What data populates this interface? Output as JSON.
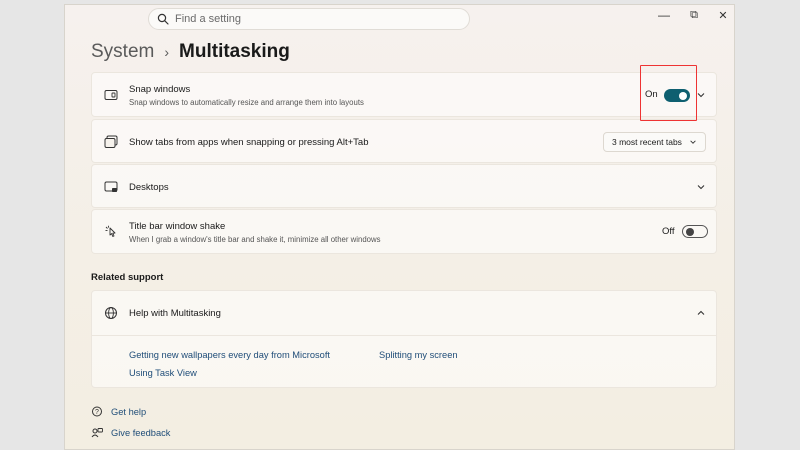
{
  "search": {
    "placeholder": "Find a setting",
    "icon": "search-icon"
  },
  "window_controls": {
    "minimize": "—",
    "restore": "⧉",
    "close": "✕"
  },
  "breadcrumb": {
    "parent": "System",
    "separator": "›",
    "current": "Multitasking"
  },
  "settings": [
    {
      "title": "Snap windows",
      "description": "Snap windows to automatically resize and arrange them into layouts",
      "icon": "snap-windows-icon",
      "toggle_label": "On",
      "toggle_state": "on",
      "expandable": true
    },
    {
      "title": "Show tabs from apps when snapping or pressing Alt+Tab",
      "icon": "tabs-icon",
      "dropdown_value": "3 most recent tabs"
    },
    {
      "title": "Desktops",
      "icon": "desktops-icon",
      "expandable": true
    },
    {
      "title": "Title bar window shake",
      "description": "When I grab a window's title bar and shake it, minimize all other windows",
      "icon": "window-shake-icon",
      "toggle_label": "Off",
      "toggle_state": "off"
    }
  ],
  "related_support": {
    "label": "Related support",
    "help": {
      "title": "Help with Multitasking",
      "icon": "globe-icon",
      "links": [
        "Getting new wallpapers every day from Microsoft",
        "Splitting my screen",
        "Using Task View"
      ]
    }
  },
  "footer": {
    "get_help": "Get help",
    "give_feedback": "Give feedback"
  },
  "colors": {
    "accent": "#0e5f70",
    "link": "#1f4d78",
    "highlight": "#e33333"
  }
}
